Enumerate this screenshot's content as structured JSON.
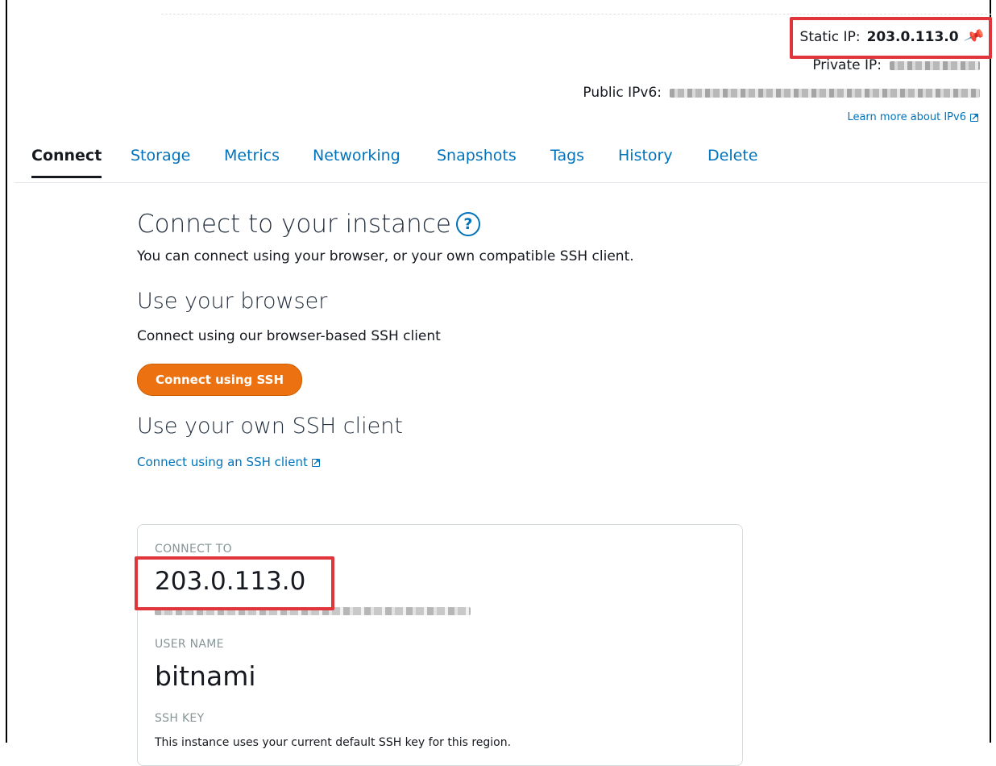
{
  "network": {
    "static_ip_label": "Static IP:",
    "static_ip_value": "203.0.113.0",
    "private_ip_label": "Private IP:",
    "public_ipv6_label": "Public IPv6:",
    "learn_more": "Learn more about IPv6"
  },
  "tabs": [
    "Connect",
    "Storage",
    "Metrics",
    "Networking",
    "Snapshots",
    "Tags",
    "History",
    "Delete"
  ],
  "active_tab": "Connect",
  "connect": {
    "title": "Connect to your instance",
    "help": "?",
    "intro": "You can connect using your browser, or your own compatible SSH client.",
    "browser_heading": "Use your browser",
    "browser_sub": "Connect using our browser-based SSH client",
    "ssh_button": "Connect using SSH",
    "client_heading": "Use your own SSH client",
    "client_link": "Connect using an SSH client"
  },
  "card": {
    "connect_to_label": "CONNECT TO",
    "connect_to_value": "203.0.113.0",
    "user_name_label": "USER NAME",
    "user_name_value": "bitnami",
    "ssh_key_label": "SSH KEY",
    "ssh_key_text": "This instance uses your current default SSH key for this region."
  },
  "colors": {
    "link": "#0073bb",
    "primary_button": "#ec7211",
    "highlight": "#e0353b"
  }
}
